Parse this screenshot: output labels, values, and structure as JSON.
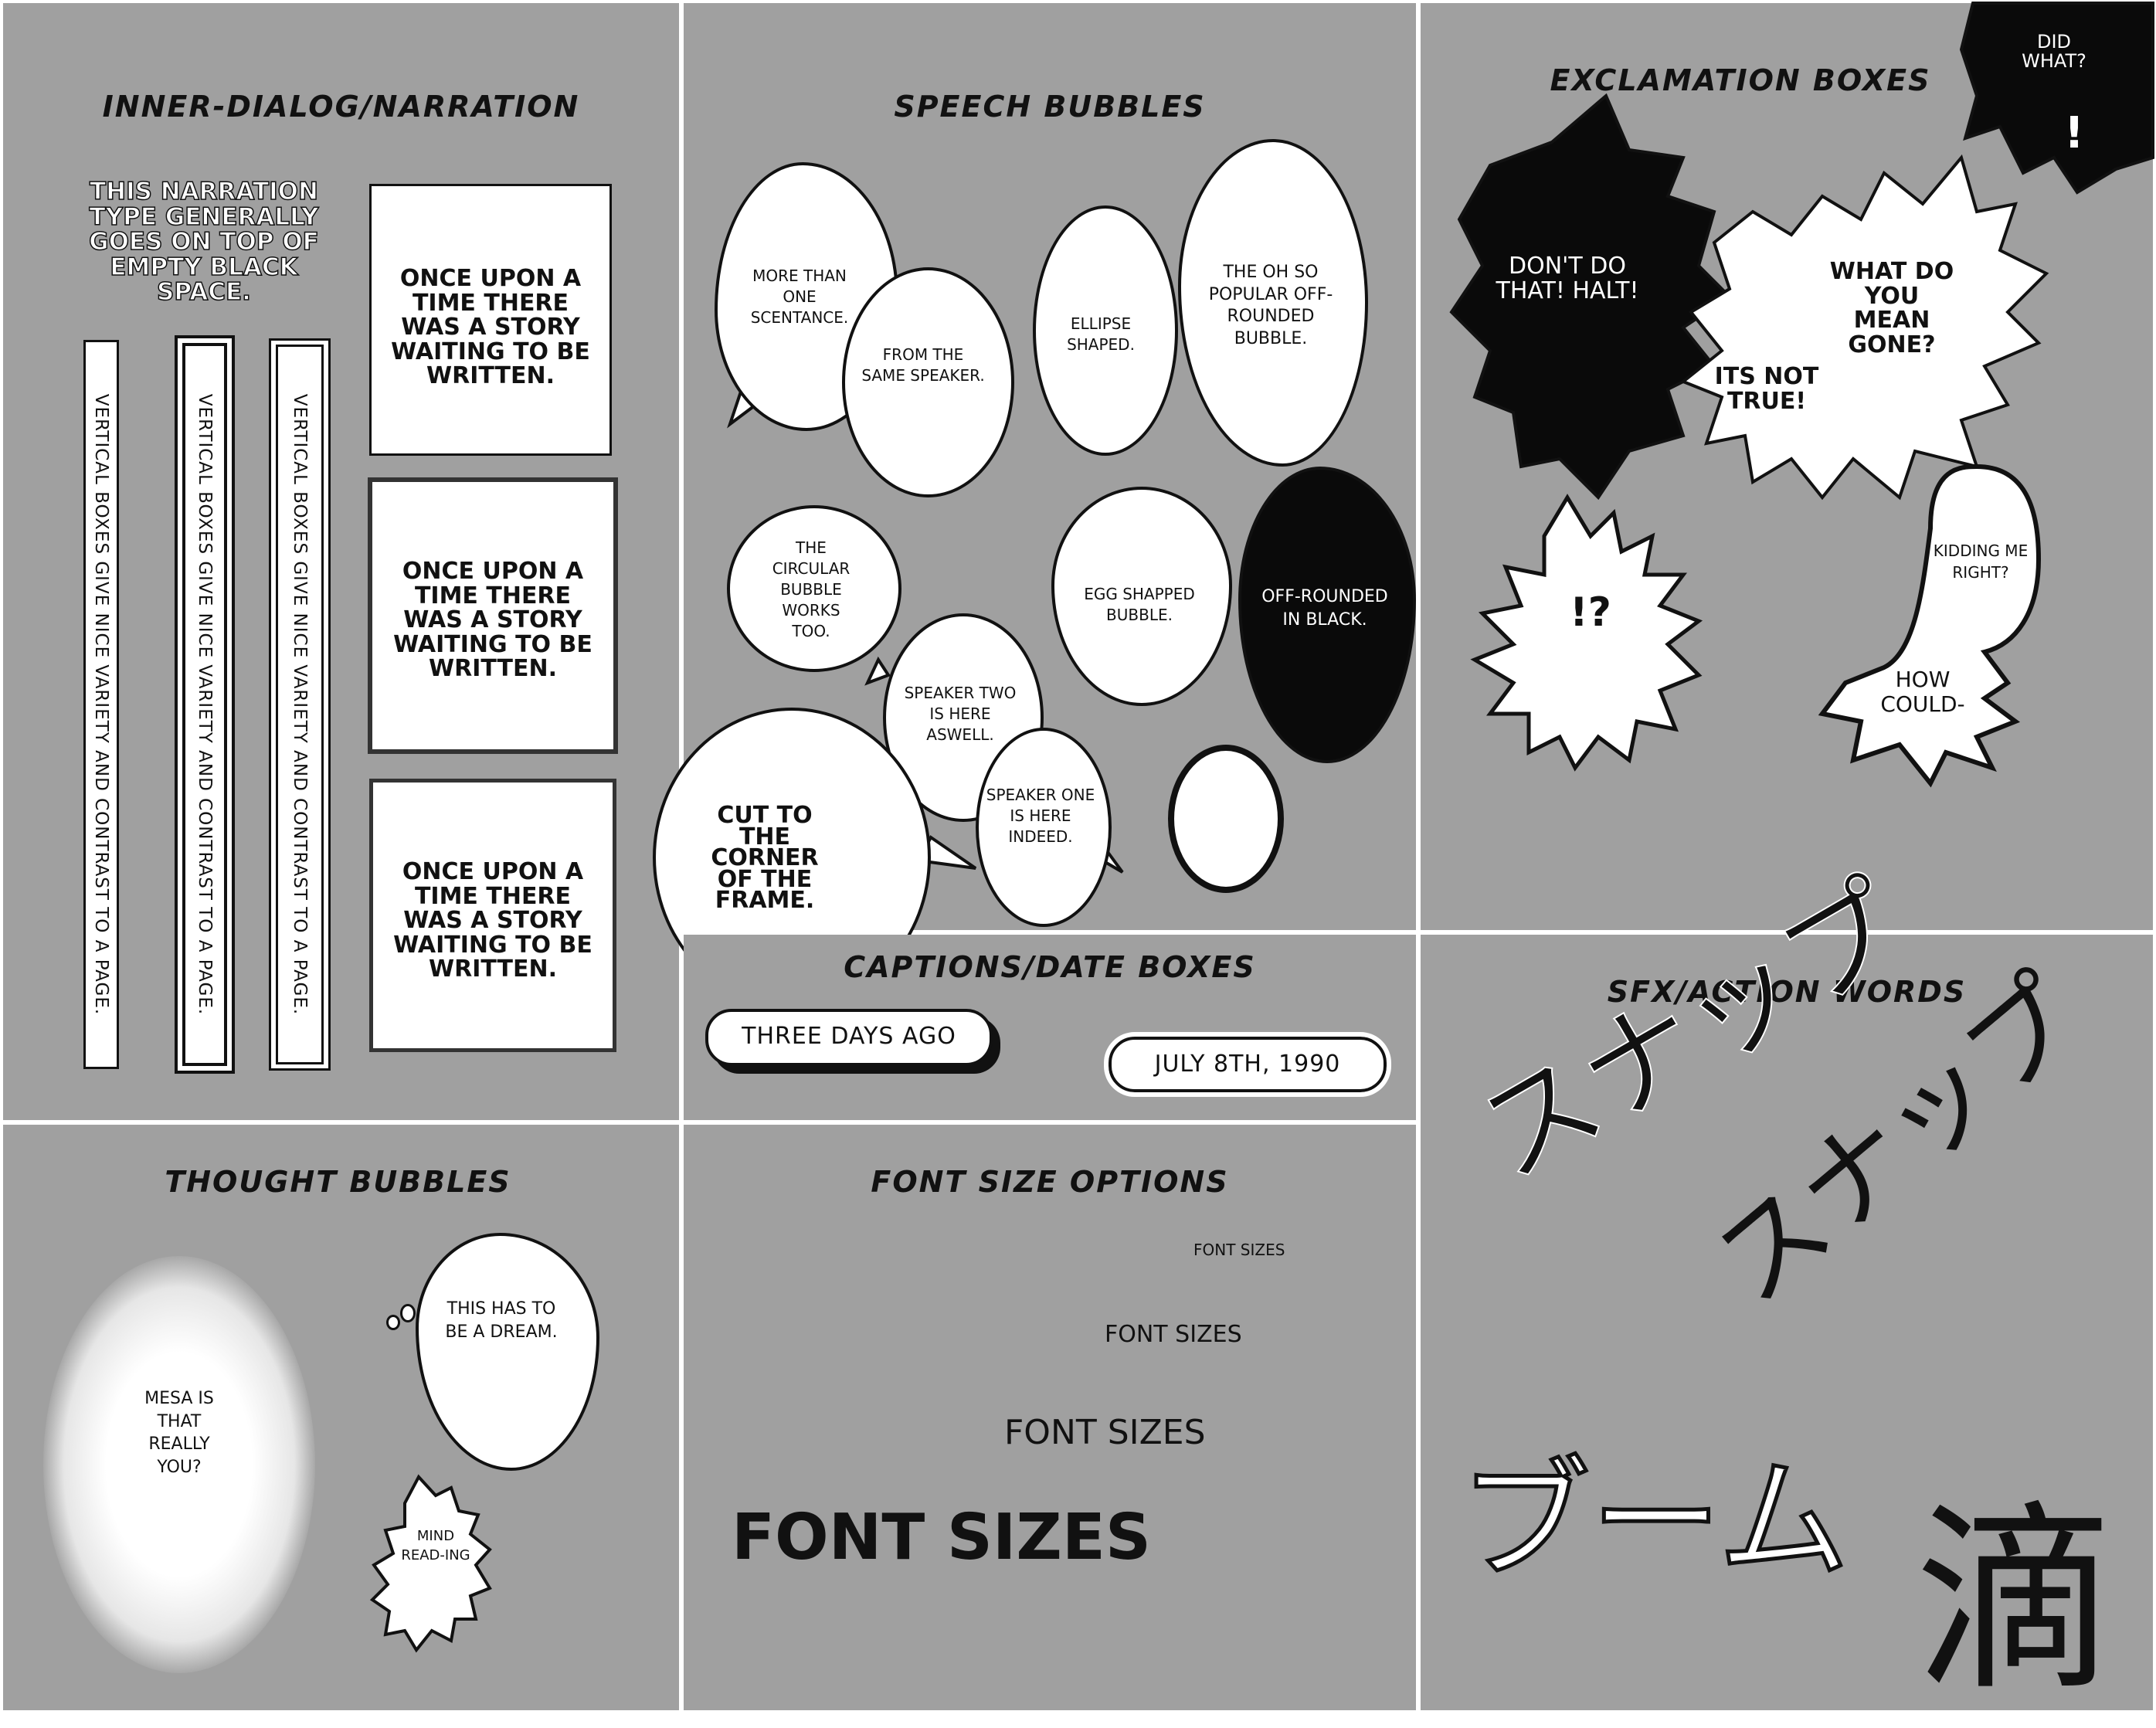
{
  "panels": {
    "inner": {
      "title": "Inner-Dialog/Narration",
      "narration": "This narration type generally goes on top of empty black space.",
      "vertical_text": "Vertical boxes give nice variety and contrast to a page.",
      "box_text": "Once upon a time there was a story waiting to be written."
    },
    "speech": {
      "title": "Speech Bubbles",
      "b1": "More than one scentance.",
      "b2": "From the same speaker.",
      "b3": "Ellipse shaped.",
      "b4": "The oh so popular off-rounded bubble.",
      "b5": "The circular bubble works too.",
      "b6": "Egg shapped bubble.",
      "b7": "Off-rounded in black.",
      "b8": "Speaker two is here aswell.",
      "b9": "Speaker one is here indeed.",
      "b10": "Cut to the corner of the frame."
    },
    "exclaim": {
      "title": "Exclamation Boxes",
      "b1": "Did what?",
      "b1b": "!",
      "b2": "Don't do that! Halt!",
      "b3": "What do you mean gone?",
      "b4": "Its not true!",
      "b5": "!?",
      "b6": "Kidding me right?",
      "b7": "How could-"
    },
    "captions": {
      "title": "Captions/Date Boxes",
      "c1": "Three days ago",
      "c2": "July 8th, 1990"
    },
    "sfx": {
      "title": "SFX/Action Words",
      "w1": "スナップ",
      "w2": "スナップ",
      "w3": "ブーム",
      "w4": "滴"
    },
    "thought": {
      "title": "Thought Bubbles",
      "t1": "Mesa is that really you?",
      "t2": "This has to be a dream.",
      "t3": "Mind read-ing"
    },
    "fonts": {
      "title": "Font Size Options",
      "s1": "Font sizes",
      "s2": "Font sizes",
      "s3": "Font sizes",
      "s4": "Font sizes"
    }
  }
}
